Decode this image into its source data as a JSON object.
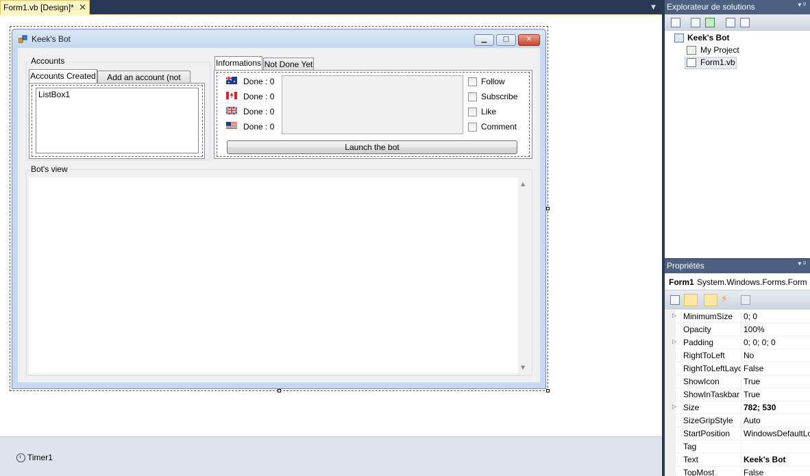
{
  "document_tab": {
    "title": "Form1.vb [Design]*",
    "close_glyph": "✕"
  },
  "form": {
    "title": "Keek's Bot",
    "caption_buttons": {
      "minimize": "▁",
      "maximize": "□",
      "close": "✕"
    },
    "accounts_group": {
      "legend": "Accounts",
      "tabs": [
        "Accounts Created",
        "Add an account (not done)"
      ],
      "listbox_text": "ListBox1"
    },
    "info_tabs": [
      "Informations",
      "Not Done Yet"
    ],
    "flags": [
      {
        "icon": "australia-flag-icon",
        "label": "Done : 0"
      },
      {
        "icon": "canada-flag-icon",
        "label": "Done : 0"
      },
      {
        "icon": "uk-flag-icon",
        "label": "Done : 0"
      },
      {
        "icon": "usa-flag-icon",
        "label": "Done : 0"
      }
    ],
    "checkboxes": [
      "Follow",
      "Subscribe",
      "Like",
      "Comment"
    ],
    "launch_button": "Launch the bot",
    "bot_view_legend": "Bot's view",
    "scroll_up": "▲",
    "scroll_down": "▼"
  },
  "component_tray": {
    "items": [
      "Timer1"
    ]
  },
  "solution_explorer": {
    "title": "Explorateur de solutions",
    "header_controls": "▾ ᵖ",
    "items": [
      {
        "label": "Keek's Bot",
        "bold": true
      },
      {
        "label": "My Project",
        "bold": false
      },
      {
        "label": "Form1.vb",
        "bold": false
      }
    ]
  },
  "properties": {
    "title": "Propriétés",
    "header_controls": "▾ ᵖ",
    "object_name": "Form1",
    "object_type": "System.Windows.Forms.Form",
    "rows": [
      {
        "name": "MinimumSize",
        "value": "0; 0",
        "expandable": true,
        "bold": false
      },
      {
        "name": "Opacity",
        "value": "100%",
        "expandable": false,
        "bold": false
      },
      {
        "name": "Padding",
        "value": "0; 0; 0; 0",
        "expandable": true,
        "bold": false
      },
      {
        "name": "RightToLeft",
        "value": "No",
        "expandable": false,
        "bold": false
      },
      {
        "name": "RightToLeftLayout",
        "value": "False",
        "expandable": false,
        "bold": false
      },
      {
        "name": "ShowIcon",
        "value": "True",
        "expandable": false,
        "bold": false
      },
      {
        "name": "ShowInTaskbar",
        "value": "True",
        "expandable": false,
        "bold": false
      },
      {
        "name": "Size",
        "value": "782; 530",
        "expandable": true,
        "bold": true
      },
      {
        "name": "SizeGripStyle",
        "value": "Auto",
        "expandable": false,
        "bold": false
      },
      {
        "name": "StartPosition",
        "value": "WindowsDefaultLocation",
        "expandable": false,
        "bold": false
      },
      {
        "name": "Tag",
        "value": "",
        "expandable": false,
        "bold": false
      },
      {
        "name": "Text",
        "value": "Keek's Bot",
        "expandable": false,
        "bold": true
      },
      {
        "name": "TopMost",
        "value": "False",
        "expandable": false,
        "bold": false
      }
    ]
  },
  "colors": {
    "ide_dark": "#293955",
    "tab_active": "#fff6c2",
    "panel_header": "#4d6082",
    "form_border": "#c7daf0"
  }
}
